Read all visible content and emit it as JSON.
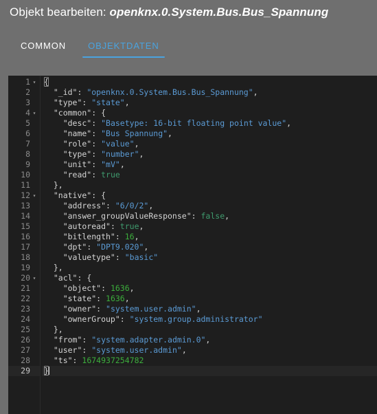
{
  "dialog": {
    "title_static": "Objekt bearbeiten: ",
    "title_object_id": "openknx.0.System.Bus.Bus_Spannung"
  },
  "tabs": [
    {
      "label": "COMMON",
      "active": false
    },
    {
      "label": "OBJEKTDATEN",
      "active": true
    }
  ],
  "colors": {
    "page_background": "#6f6f6f",
    "editor_background": "#1e1e1e",
    "accent": "#4aa3df",
    "string": "#5b9bd5",
    "number": "#3cae3c",
    "boolean": "#3f9b6e",
    "punctuation": "#d4d4d4",
    "gutter_text": "#8b8b8b",
    "active_line": "#262626"
  },
  "editor": {
    "total_lines": 29,
    "cursor_line": 29,
    "fold_lines": [
      1,
      4,
      12,
      20
    ],
    "lines": [
      {
        "n": 1,
        "fold": true,
        "tokens": [
          {
            "t": "{",
            "c": "punc",
            "match": true
          }
        ]
      },
      {
        "n": 2,
        "fold": false,
        "tokens": [
          {
            "t": "  \"_id\"",
            "c": "key"
          },
          {
            "t": ": ",
            "c": "punc"
          },
          {
            "t": "\"openknx.0.System.Bus.Bus_Spannung\"",
            "c": "str"
          },
          {
            "t": ",",
            "c": "punc"
          }
        ]
      },
      {
        "n": 3,
        "fold": false,
        "tokens": [
          {
            "t": "  \"type\"",
            "c": "key"
          },
          {
            "t": ": ",
            "c": "punc"
          },
          {
            "t": "\"state\"",
            "c": "str"
          },
          {
            "t": ",",
            "c": "punc"
          }
        ]
      },
      {
        "n": 4,
        "fold": true,
        "tokens": [
          {
            "t": "  \"common\"",
            "c": "key"
          },
          {
            "t": ": {",
            "c": "punc"
          }
        ]
      },
      {
        "n": 5,
        "fold": false,
        "tokens": [
          {
            "t": "    \"desc\"",
            "c": "key"
          },
          {
            "t": ": ",
            "c": "punc"
          },
          {
            "t": "\"Basetype: 16-bit floating point value\"",
            "c": "str"
          },
          {
            "t": ",",
            "c": "punc"
          }
        ]
      },
      {
        "n": 6,
        "fold": false,
        "tokens": [
          {
            "t": "    \"name\"",
            "c": "key"
          },
          {
            "t": ": ",
            "c": "punc"
          },
          {
            "t": "\"Bus Spannung\"",
            "c": "str"
          },
          {
            "t": ",",
            "c": "punc"
          }
        ]
      },
      {
        "n": 7,
        "fold": false,
        "tokens": [
          {
            "t": "    \"role\"",
            "c": "key"
          },
          {
            "t": ": ",
            "c": "punc"
          },
          {
            "t": "\"value\"",
            "c": "str"
          },
          {
            "t": ",",
            "c": "punc"
          }
        ]
      },
      {
        "n": 8,
        "fold": false,
        "tokens": [
          {
            "t": "    \"type\"",
            "c": "key"
          },
          {
            "t": ": ",
            "c": "punc"
          },
          {
            "t": "\"number\"",
            "c": "str"
          },
          {
            "t": ",",
            "c": "punc"
          }
        ]
      },
      {
        "n": 9,
        "fold": false,
        "tokens": [
          {
            "t": "    \"unit\"",
            "c": "key"
          },
          {
            "t": ": ",
            "c": "punc"
          },
          {
            "t": "\"mV\"",
            "c": "str"
          },
          {
            "t": ",",
            "c": "punc"
          }
        ]
      },
      {
        "n": 10,
        "fold": false,
        "tokens": [
          {
            "t": "    \"read\"",
            "c": "key"
          },
          {
            "t": ": ",
            "c": "punc"
          },
          {
            "t": "true",
            "c": "bool"
          }
        ]
      },
      {
        "n": 11,
        "fold": false,
        "tokens": [
          {
            "t": "  },",
            "c": "punc"
          }
        ]
      },
      {
        "n": 12,
        "fold": true,
        "tokens": [
          {
            "t": "  \"native\"",
            "c": "key"
          },
          {
            "t": ": {",
            "c": "punc"
          }
        ]
      },
      {
        "n": 13,
        "fold": false,
        "tokens": [
          {
            "t": "    \"address\"",
            "c": "key"
          },
          {
            "t": ": ",
            "c": "punc"
          },
          {
            "t": "\"6/0/2\"",
            "c": "str"
          },
          {
            "t": ",",
            "c": "punc"
          }
        ]
      },
      {
        "n": 14,
        "fold": false,
        "tokens": [
          {
            "t": "    \"answer_groupValueResponse\"",
            "c": "key"
          },
          {
            "t": ": ",
            "c": "punc"
          },
          {
            "t": "false",
            "c": "bool"
          },
          {
            "t": ",",
            "c": "punc"
          }
        ]
      },
      {
        "n": 15,
        "fold": false,
        "tokens": [
          {
            "t": "    \"autoread\"",
            "c": "key"
          },
          {
            "t": ": ",
            "c": "punc"
          },
          {
            "t": "true",
            "c": "bool"
          },
          {
            "t": ",",
            "c": "punc"
          }
        ]
      },
      {
        "n": 16,
        "fold": false,
        "tokens": [
          {
            "t": "    \"bitlength\"",
            "c": "key"
          },
          {
            "t": ": ",
            "c": "punc"
          },
          {
            "t": "16",
            "c": "num"
          },
          {
            "t": ",",
            "c": "punc"
          }
        ]
      },
      {
        "n": 17,
        "fold": false,
        "tokens": [
          {
            "t": "    \"dpt\"",
            "c": "key"
          },
          {
            "t": ": ",
            "c": "punc"
          },
          {
            "t": "\"DPT9.020\"",
            "c": "str"
          },
          {
            "t": ",",
            "c": "punc"
          }
        ]
      },
      {
        "n": 18,
        "fold": false,
        "tokens": [
          {
            "t": "    \"valuetype\"",
            "c": "key"
          },
          {
            "t": ": ",
            "c": "punc"
          },
          {
            "t": "\"basic\"",
            "c": "str"
          }
        ]
      },
      {
        "n": 19,
        "fold": false,
        "tokens": [
          {
            "t": "  },",
            "c": "punc"
          }
        ]
      },
      {
        "n": 20,
        "fold": true,
        "tokens": [
          {
            "t": "  \"acl\"",
            "c": "key"
          },
          {
            "t": ": {",
            "c": "punc"
          }
        ]
      },
      {
        "n": 21,
        "fold": false,
        "tokens": [
          {
            "t": "    \"object\"",
            "c": "key"
          },
          {
            "t": ": ",
            "c": "punc"
          },
          {
            "t": "1636",
            "c": "num"
          },
          {
            "t": ",",
            "c": "punc"
          }
        ]
      },
      {
        "n": 22,
        "fold": false,
        "tokens": [
          {
            "t": "    \"state\"",
            "c": "key"
          },
          {
            "t": ": ",
            "c": "punc"
          },
          {
            "t": "1636",
            "c": "num"
          },
          {
            "t": ",",
            "c": "punc"
          }
        ]
      },
      {
        "n": 23,
        "fold": false,
        "tokens": [
          {
            "t": "    \"owner\"",
            "c": "key"
          },
          {
            "t": ": ",
            "c": "punc"
          },
          {
            "t": "\"system.user.admin\"",
            "c": "str"
          },
          {
            "t": ",",
            "c": "punc"
          }
        ]
      },
      {
        "n": 24,
        "fold": false,
        "tokens": [
          {
            "t": "    \"ownerGroup\"",
            "c": "key"
          },
          {
            "t": ": ",
            "c": "punc"
          },
          {
            "t": "\"system.group.administrator\"",
            "c": "str"
          }
        ]
      },
      {
        "n": 25,
        "fold": false,
        "tokens": [
          {
            "t": "  },",
            "c": "punc"
          }
        ]
      },
      {
        "n": 26,
        "fold": false,
        "tokens": [
          {
            "t": "  \"from\"",
            "c": "key"
          },
          {
            "t": ": ",
            "c": "punc"
          },
          {
            "t": "\"system.adapter.admin.0\"",
            "c": "str"
          },
          {
            "t": ",",
            "c": "punc"
          }
        ]
      },
      {
        "n": 27,
        "fold": false,
        "tokens": [
          {
            "t": "  \"user\"",
            "c": "key"
          },
          {
            "t": ": ",
            "c": "punc"
          },
          {
            "t": "\"system.user.admin\"",
            "c": "str"
          },
          {
            "t": ",",
            "c": "punc"
          }
        ]
      },
      {
        "n": 28,
        "fold": false,
        "tokens": [
          {
            "t": "  \"ts\"",
            "c": "key"
          },
          {
            "t": ": ",
            "c": "punc"
          },
          {
            "t": "1674937254782",
            "c": "num"
          }
        ]
      },
      {
        "n": 29,
        "fold": false,
        "active": true,
        "cursor": true,
        "tokens": [
          {
            "t": "}",
            "c": "punc",
            "match": true
          }
        ]
      }
    ]
  },
  "icons": {
    "fold_open": "▾"
  }
}
